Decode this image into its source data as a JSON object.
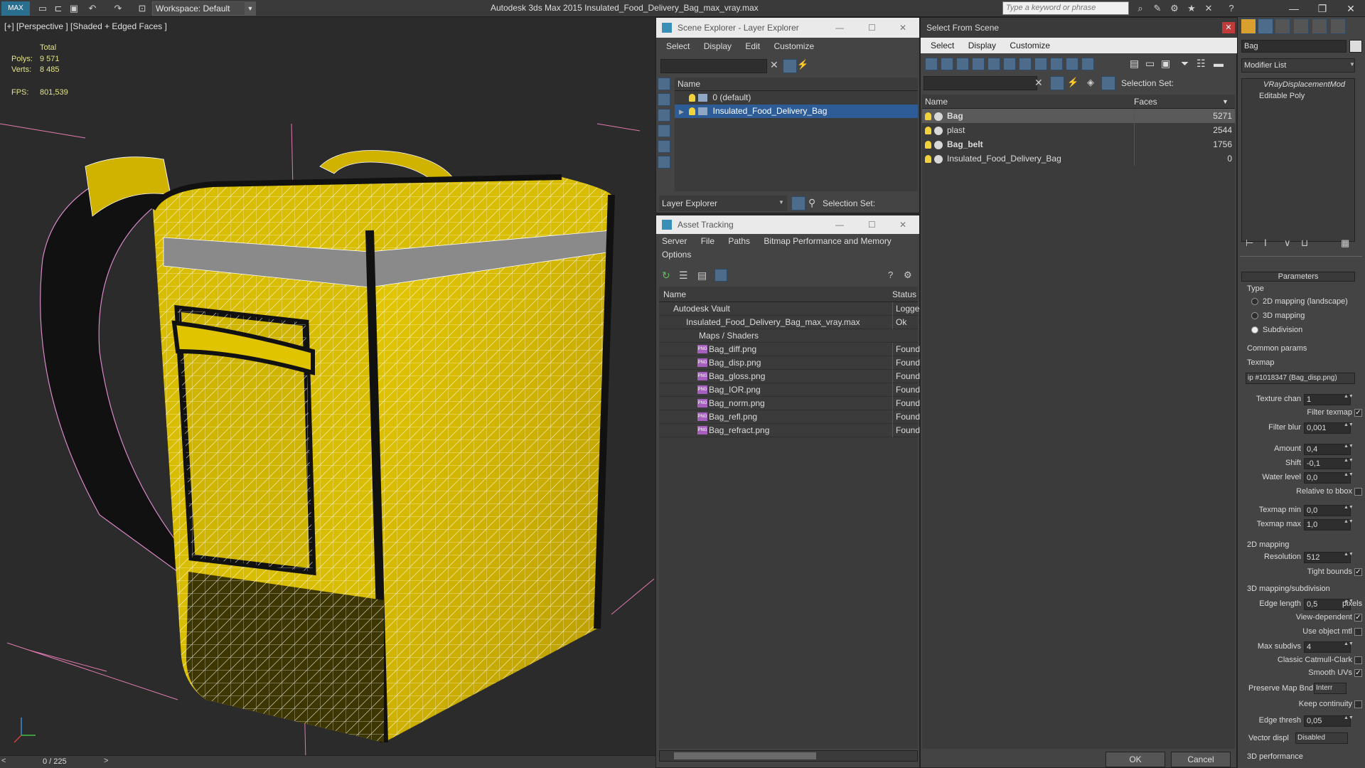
{
  "app": {
    "workspace": "Workspace: Default",
    "title": "Autodesk 3ds Max  2015     Insulated_Food_Delivery_Bag_max_vray.max",
    "search_placeholder": "Type a keyword or phrase"
  },
  "viewport": {
    "label": "[+] [Perspective ] [Shaded + Edged Faces ]",
    "stats": {
      "total_label": "Total",
      "polys_label": "Polys:",
      "polys": "9 571",
      "verts_label": "Verts:",
      "verts": "8 485",
      "fps_label": "FPS:",
      "fps": "801,539"
    },
    "timeline": "0 / 225"
  },
  "scene_explorer": {
    "title": "Scene Explorer - Layer Explorer",
    "menu": [
      "Select",
      "Display",
      "Edit",
      "Customize"
    ],
    "column": "Name",
    "rows": [
      "0 (default)",
      "Insulated_Food_Delivery_Bag"
    ],
    "explorer_label": "Layer Explorer",
    "selection_set_label": "Selection Set:"
  },
  "asset_tracking": {
    "title": "Asset Tracking",
    "menu": [
      "Server",
      "File",
      "Paths",
      "Bitmap Performance and Memory"
    ],
    "menu2": "Options",
    "columns": [
      "Name",
      "Status"
    ],
    "rows": [
      {
        "name": "Autodesk Vault",
        "status": "Logged"
      },
      {
        "name": "Insulated_Food_Delivery_Bag_max_vray.max",
        "status": "Ok"
      },
      {
        "name": "Maps / Shaders",
        "status": ""
      },
      {
        "name": "Bag_diff.png",
        "status": "Found"
      },
      {
        "name": "Bag_disp.png",
        "status": "Found"
      },
      {
        "name": "Bag_gloss.png",
        "status": "Found"
      },
      {
        "name": "Bag_IOR.png",
        "status": "Found"
      },
      {
        "name": "Bag_norm.png",
        "status": "Found"
      },
      {
        "name": "Bag_refl.png",
        "status": "Found"
      },
      {
        "name": "Bag_refract.png",
        "status": "Found"
      }
    ]
  },
  "select_from_scene": {
    "title": "Select From Scene",
    "menu": [
      "Select",
      "Display",
      "Customize"
    ],
    "selection_set_label": "Selection Set:",
    "columns": [
      "Name",
      "Faces"
    ],
    "rows": [
      {
        "name": "Bag",
        "faces": "5271"
      },
      {
        "name": "plast",
        "faces": "2544"
      },
      {
        "name": "Bag_belt",
        "faces": "1756"
      },
      {
        "name": "Insulated_Food_Delivery_Bag",
        "faces": "0"
      }
    ],
    "ok": "OK",
    "cancel": "Cancel"
  },
  "command_panel": {
    "object_name": "Bag",
    "modifier_list": "Modifier List",
    "stack": [
      "VRayDisplacementMod",
      "Editable Poly"
    ],
    "rollout": "Parameters",
    "type_label": "Type",
    "types": [
      "2D mapping (landscape)",
      "3D mapping",
      "Subdivision"
    ],
    "common_params": "Common params",
    "texmap_label": "Texmap",
    "texmap_value": "ip #1018347 (Bag_disp.png)",
    "fields": [
      {
        "label": "Texture chan",
        "value": "1"
      },
      {
        "label": "Filter blur",
        "value": "0,001"
      },
      {
        "label": "Amount",
        "value": "0,4"
      },
      {
        "label": "Shift",
        "value": "-0,1"
      },
      {
        "label": "Water level",
        "value": "0,0"
      },
      {
        "label": "Texmap min",
        "value": "0,0"
      },
      {
        "label": "Texmap max",
        "value": "1,0"
      },
      {
        "label": "Resolution",
        "value": "512"
      },
      {
        "label": "Edge length",
        "value": "0,5"
      },
      {
        "label": "Max subdivs",
        "value": "4"
      },
      {
        "label": "Edge thresh",
        "value": "0,05"
      }
    ],
    "filter_texmap": "Filter texmap",
    "relative_to_bbox": "Relative to bbox",
    "mapping_2d": "2D mapping",
    "tight_bounds": "Tight bounds",
    "mapping_3d": "3D mapping/subdivision",
    "pixels": "pixels",
    "view_dependent": "View-dependent",
    "use_object_mtl": "Use object mtl",
    "classic_cc": "Classic Catmull-Clark",
    "smooth_uvs": "Smooth UVs",
    "preserve_map_bnd": "Preserve Map Bnd",
    "preserve_value": "Interr",
    "keep_continuity": "Keep continuity",
    "vector_displ": "Vector displ",
    "vector_value": "Disabled",
    "perf": "3D performance"
  }
}
